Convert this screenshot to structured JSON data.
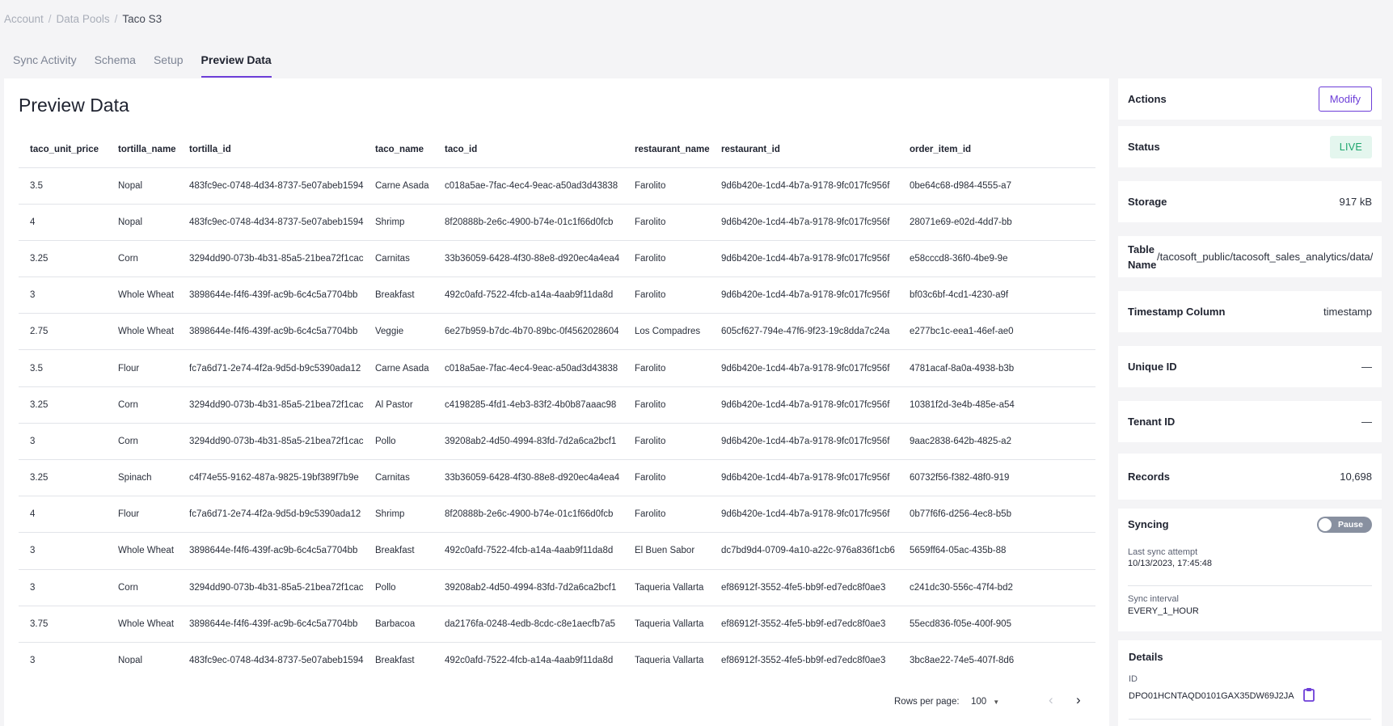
{
  "breadcrumb": [
    {
      "label": "Account"
    },
    {
      "label": "Data Pools"
    },
    {
      "label": "Taco S3"
    }
  ],
  "breadcrumb_separator": "/",
  "tabs": [
    {
      "label": "Sync Activity",
      "active": false
    },
    {
      "label": "Schema",
      "active": false
    },
    {
      "label": "Setup",
      "active": false
    },
    {
      "label": "Preview Data",
      "active": true
    }
  ],
  "main": {
    "title": "Preview Data",
    "columns": [
      "taco_unit_price",
      "tortilla_name",
      "tortilla_id",
      "taco_name",
      "taco_id",
      "restaurant_name",
      "restaurant_id",
      "order_item_id"
    ],
    "rows": [
      [
        "3.5",
        "Nopal",
        "483fc9ec-0748-4d34-8737-5e07abeb1594",
        "Carne Asada",
        "c018a5ae-7fac-4ec4-9eac-a50ad3d43838",
        "Farolito",
        "9d6b420e-1cd4-4b7a-9178-9fc017fc956f",
        "0be64c68-d984-4555-a7"
      ],
      [
        "4",
        "Nopal",
        "483fc9ec-0748-4d34-8737-5e07abeb1594",
        "Shrimp",
        "8f20888b-2e6c-4900-b74e-01c1f66d0fcb",
        "Farolito",
        "9d6b420e-1cd4-4b7a-9178-9fc017fc956f",
        "28071e69-e02d-4dd7-bb"
      ],
      [
        "3.25",
        "Corn",
        "3294dd90-073b-4b31-85a5-21bea72f1cac",
        "Carnitas",
        "33b36059-6428-4f30-88e8-d920ec4a4ea4",
        "Farolito",
        "9d6b420e-1cd4-4b7a-9178-9fc017fc956f",
        "e58cccd8-36f0-4be9-9e"
      ],
      [
        "3",
        "Whole Wheat",
        "3898644e-f4f6-439f-ac9b-6c4c5a7704bb",
        "Breakfast",
        "492c0afd-7522-4fcb-a14a-4aab9f11da8d",
        "Farolito",
        "9d6b420e-1cd4-4b7a-9178-9fc017fc956f",
        "bf03c6bf-4cd1-4230-a9f"
      ],
      [
        "2.75",
        "Whole Wheat",
        "3898644e-f4f6-439f-ac9b-6c4c5a7704bb",
        "Veggie",
        "6e27b959-b7dc-4b70-89bc-0f4562028604",
        "Los Compadres",
        "605cf627-794e-47f6-9f23-19c8dda7c24a",
        "e277bc1c-eea1-46ef-ae0"
      ],
      [
        "3.5",
        "Flour",
        "fc7a6d71-2e74-4f2a-9d5d-b9c5390ada12",
        "Carne Asada",
        "c018a5ae-7fac-4ec4-9eac-a50ad3d43838",
        "Farolito",
        "9d6b420e-1cd4-4b7a-9178-9fc017fc956f",
        "4781acaf-8a0a-4938-b3b"
      ],
      [
        "3.25",
        "Corn",
        "3294dd90-073b-4b31-85a5-21bea72f1cac",
        "Al Pastor",
        "c4198285-4fd1-4eb3-83f2-4b0b87aaac98",
        "Farolito",
        "9d6b420e-1cd4-4b7a-9178-9fc017fc956f",
        "10381f2d-3e4b-485e-a54"
      ],
      [
        "3",
        "Corn",
        "3294dd90-073b-4b31-85a5-21bea72f1cac",
        "Pollo",
        "39208ab2-4d50-4994-83fd-7d2a6ca2bcf1",
        "Farolito",
        "9d6b420e-1cd4-4b7a-9178-9fc017fc956f",
        "9aac2838-642b-4825-a2"
      ],
      [
        "3.25",
        "Spinach",
        "c4f74e55-9162-487a-9825-19bf389f7b9e",
        "Carnitas",
        "33b36059-6428-4f30-88e8-d920ec4a4ea4",
        "Farolito",
        "9d6b420e-1cd4-4b7a-9178-9fc017fc956f",
        "60732f56-f382-48f0-919"
      ],
      [
        "4",
        "Flour",
        "fc7a6d71-2e74-4f2a-9d5d-b9c5390ada12",
        "Shrimp",
        "8f20888b-2e6c-4900-b74e-01c1f66d0fcb",
        "Farolito",
        "9d6b420e-1cd4-4b7a-9178-9fc017fc956f",
        "0b77f6f6-d256-4ec8-b5b"
      ],
      [
        "3",
        "Whole Wheat",
        "3898644e-f4f6-439f-ac9b-6c4c5a7704bb",
        "Breakfast",
        "492c0afd-7522-4fcb-a14a-4aab9f11da8d",
        "El Buen Sabor",
        "dc7bd9d4-0709-4a10-a22c-976a836f1cb6",
        "5659ff64-05ac-435b-88"
      ],
      [
        "3",
        "Corn",
        "3294dd90-073b-4b31-85a5-21bea72f1cac",
        "Pollo",
        "39208ab2-4d50-4994-83fd-7d2a6ca2bcf1",
        "Taqueria Vallarta",
        "ef86912f-3552-4fe5-bb9f-ed7edc8f0ae3",
        "c241dc30-556c-47f4-bd2"
      ],
      [
        "3.75",
        "Whole Wheat",
        "3898644e-f4f6-439f-ac9b-6c4c5a7704bb",
        "Barbacoa",
        "da2176fa-0248-4edb-8cdc-c8e1aecfb7a5",
        "Taqueria Vallarta",
        "ef86912f-3552-4fe5-bb9f-ed7edc8f0ae3",
        "55ecd836-f05e-400f-905"
      ],
      [
        "3",
        "Nopal",
        "483fc9ec-0748-4d34-8737-5e07abeb1594",
        "Breakfast",
        "492c0afd-7522-4fcb-a14a-4aab9f11da8d",
        "Taqueria Vallarta",
        "ef86912f-3552-4fe5-bb9f-ed7edc8f0ae3",
        "3bc8ae22-74e5-407f-8d6"
      ]
    ],
    "pagination": {
      "rows_per_page_label": "Rows per page:",
      "rows_per_page_value": "100",
      "caret_icon": "▼",
      "prev_icon": "‹",
      "next_icon": "›"
    }
  },
  "sidebar": {
    "actions": {
      "label": "Actions",
      "button": "Modify"
    },
    "status": {
      "label": "Status",
      "value": "LIVE",
      "color": "#1ba56c"
    },
    "storage": {
      "label": "Storage",
      "value": "917 kB"
    },
    "table_name": {
      "label": "Table Name",
      "value": "/tacosoft_public/tacosoft_sales_analytics/data/"
    },
    "timestamp_column": {
      "label": "Timestamp Column",
      "value": "timestamp"
    },
    "unique_id": {
      "label": "Unique ID",
      "value": "—"
    },
    "tenant_id": {
      "label": "Tenant ID",
      "value": "—"
    },
    "records": {
      "label": "Records",
      "value": "10,698"
    },
    "syncing": {
      "label": "Syncing",
      "toggle_label": "Pause",
      "last_sync_label": "Last sync attempt",
      "last_sync_value": "10/13/2023, 17:45:48",
      "interval_label": "Sync interval",
      "interval_value": "EVERY_1_HOUR"
    },
    "details": {
      "title": "Details",
      "id_label": "ID",
      "id_value": "DPO01HCNTAQD0101GAX35DW69J2JA",
      "copy_icon": "clipboard-icon"
    }
  },
  "colors": {
    "accent": "#6d3ed8",
    "live": "#1ba56c",
    "live_bg": "#e4f6ee"
  }
}
